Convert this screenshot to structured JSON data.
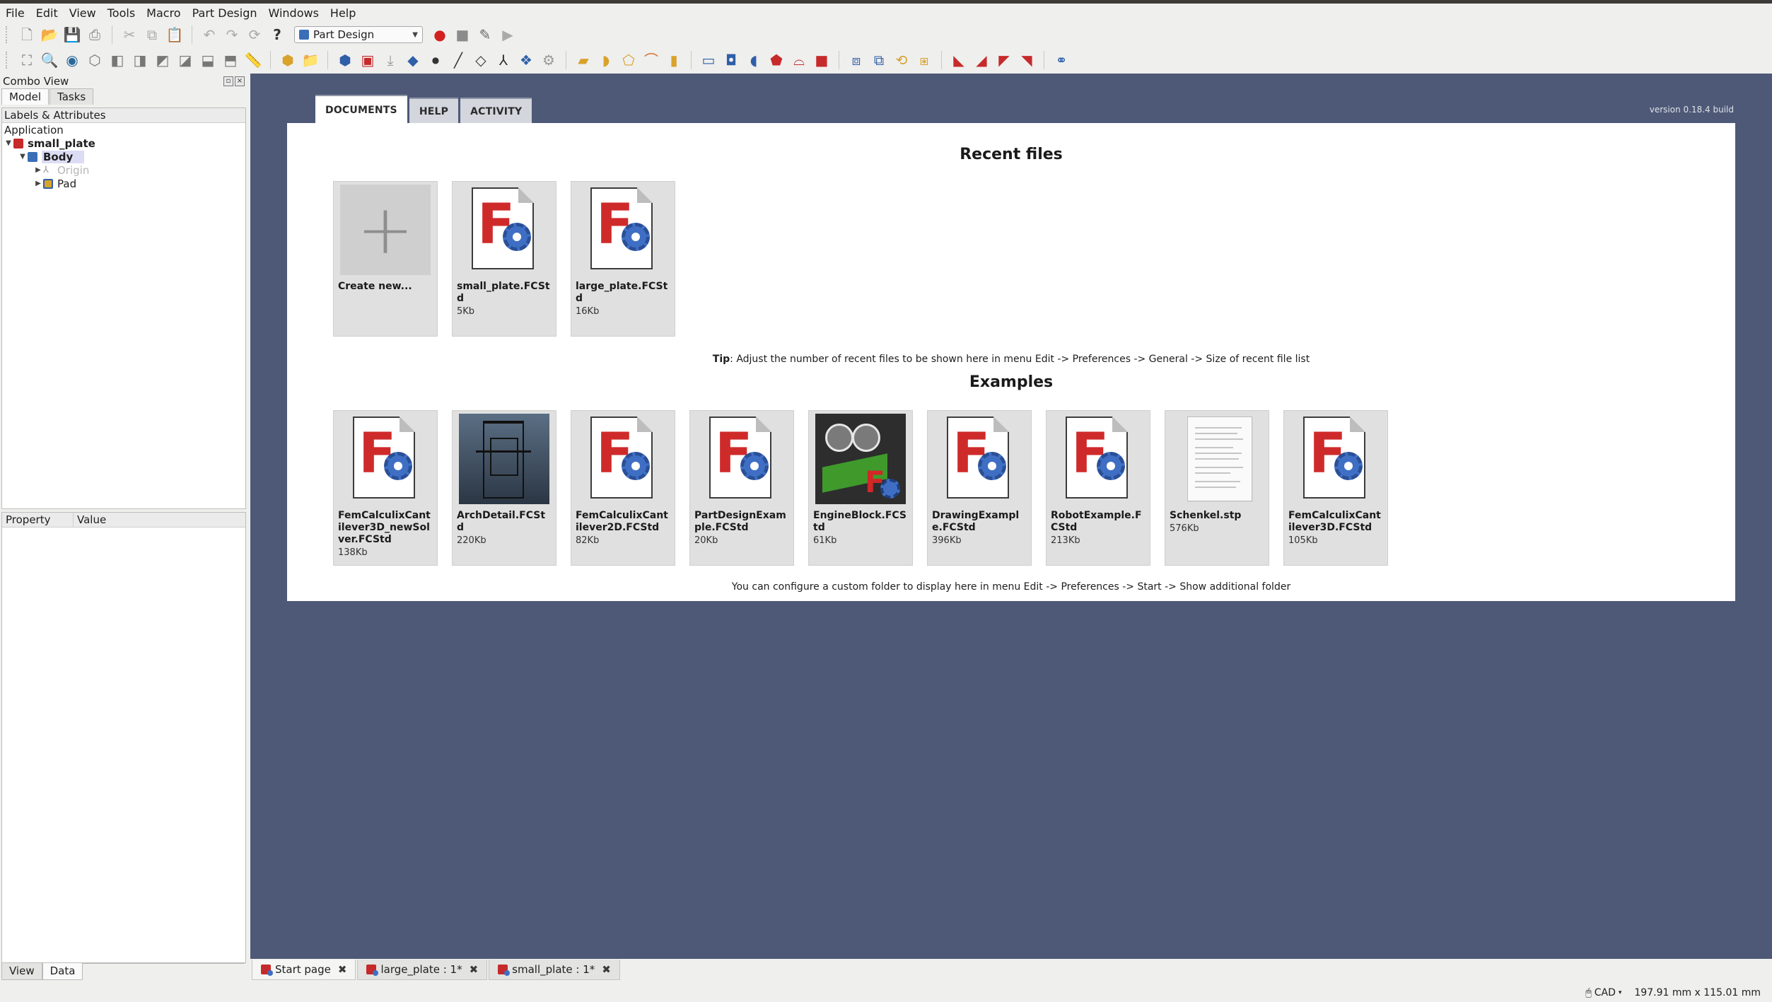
{
  "menu": [
    "File",
    "Edit",
    "View",
    "Tools",
    "Macro",
    "Part Design",
    "Windows",
    "Help"
  ],
  "workbench": {
    "selected": "Part Design"
  },
  "toolbar1_icons": [
    "new-document-icon",
    "open-icon",
    "save-icon",
    "save-as-icon",
    "print-icon",
    "cut-icon",
    "copy-icon",
    "paste-icon",
    "undo-icon",
    "redo-icon",
    "refresh-icon",
    "whats-this-icon",
    "workbench-selector",
    "record-macro-icon",
    "stop-macro-icon",
    "edit-macro-icon",
    "run-macro-icon"
  ],
  "combo": {
    "title": "Combo View",
    "tabs": [
      "Model",
      "Tasks"
    ],
    "tree_header": "Labels & Attributes",
    "tree_root": "Application",
    "tree": [
      {
        "label": "small_plate",
        "bold": true
      },
      {
        "label": "Body",
        "bold": true
      },
      {
        "label": "Origin",
        "faded": true
      },
      {
        "label": "Pad"
      }
    ],
    "prop_headers": [
      "Property",
      "Value"
    ],
    "bottom_tabs": [
      "View",
      "Data"
    ]
  },
  "start": {
    "tabs": [
      "DOCUMENTS",
      "HELP",
      "ACTIVITY"
    ],
    "version": "version 0.18.4 build",
    "recent_title": "Recent files",
    "recent": [
      {
        "name": "Create new...",
        "size": ""
      },
      {
        "name": "small_plate.FCStd",
        "size": "5Kb"
      },
      {
        "name": "large_plate.FCStd",
        "size": "16Kb"
      }
    ],
    "tip_bold": "Tip",
    "tip_text": ": Adjust the number of recent files to be shown here in menu Edit -> Preferences -> General -> Size of recent file list",
    "examples_title": "Examples",
    "examples": [
      {
        "name": "FemCalculixCantilever3D_newSolver.FCStd",
        "size": "138Kb",
        "thumb": "freecad"
      },
      {
        "name": "ArchDetail.FCStd",
        "size": "220Kb",
        "thumb": "arch"
      },
      {
        "name": "FemCalculixCantilever2D.FCStd",
        "size": "82Kb",
        "thumb": "freecad"
      },
      {
        "name": "PartDesignExample.FCStd",
        "size": "20Kb",
        "thumb": "freecad"
      },
      {
        "name": "EngineBlock.FCStd",
        "size": "61Kb",
        "thumb": "engine"
      },
      {
        "name": "DrawingExample.FCStd",
        "size": "396Kb",
        "thumb": "freecad"
      },
      {
        "name": "RobotExample.FCStd",
        "size": "213Kb",
        "thumb": "freecad"
      },
      {
        "name": "Schenkel.stp",
        "size": "576Kb",
        "thumb": "text"
      },
      {
        "name": "FemCalculixCantilever3D.FCStd",
        "size": "105Kb",
        "thumb": "freecad"
      }
    ],
    "folder_note": "You can configure a custom folder to display here in menu Edit -> Preferences -> Start -> Show additional folder"
  },
  "doc_tabs": [
    {
      "label": "Start page",
      "active": true
    },
    {
      "label": "large_plate : 1*"
    },
    {
      "label": "small_plate : 1*"
    }
  ],
  "status": {
    "nav": "CAD",
    "dimensions": "197.91 mm x 115.01 mm"
  },
  "colors": {
    "view_bg": "#4e5977",
    "freecad_red": "#cf2a2a",
    "gear_blue": "#3f6fc4"
  }
}
